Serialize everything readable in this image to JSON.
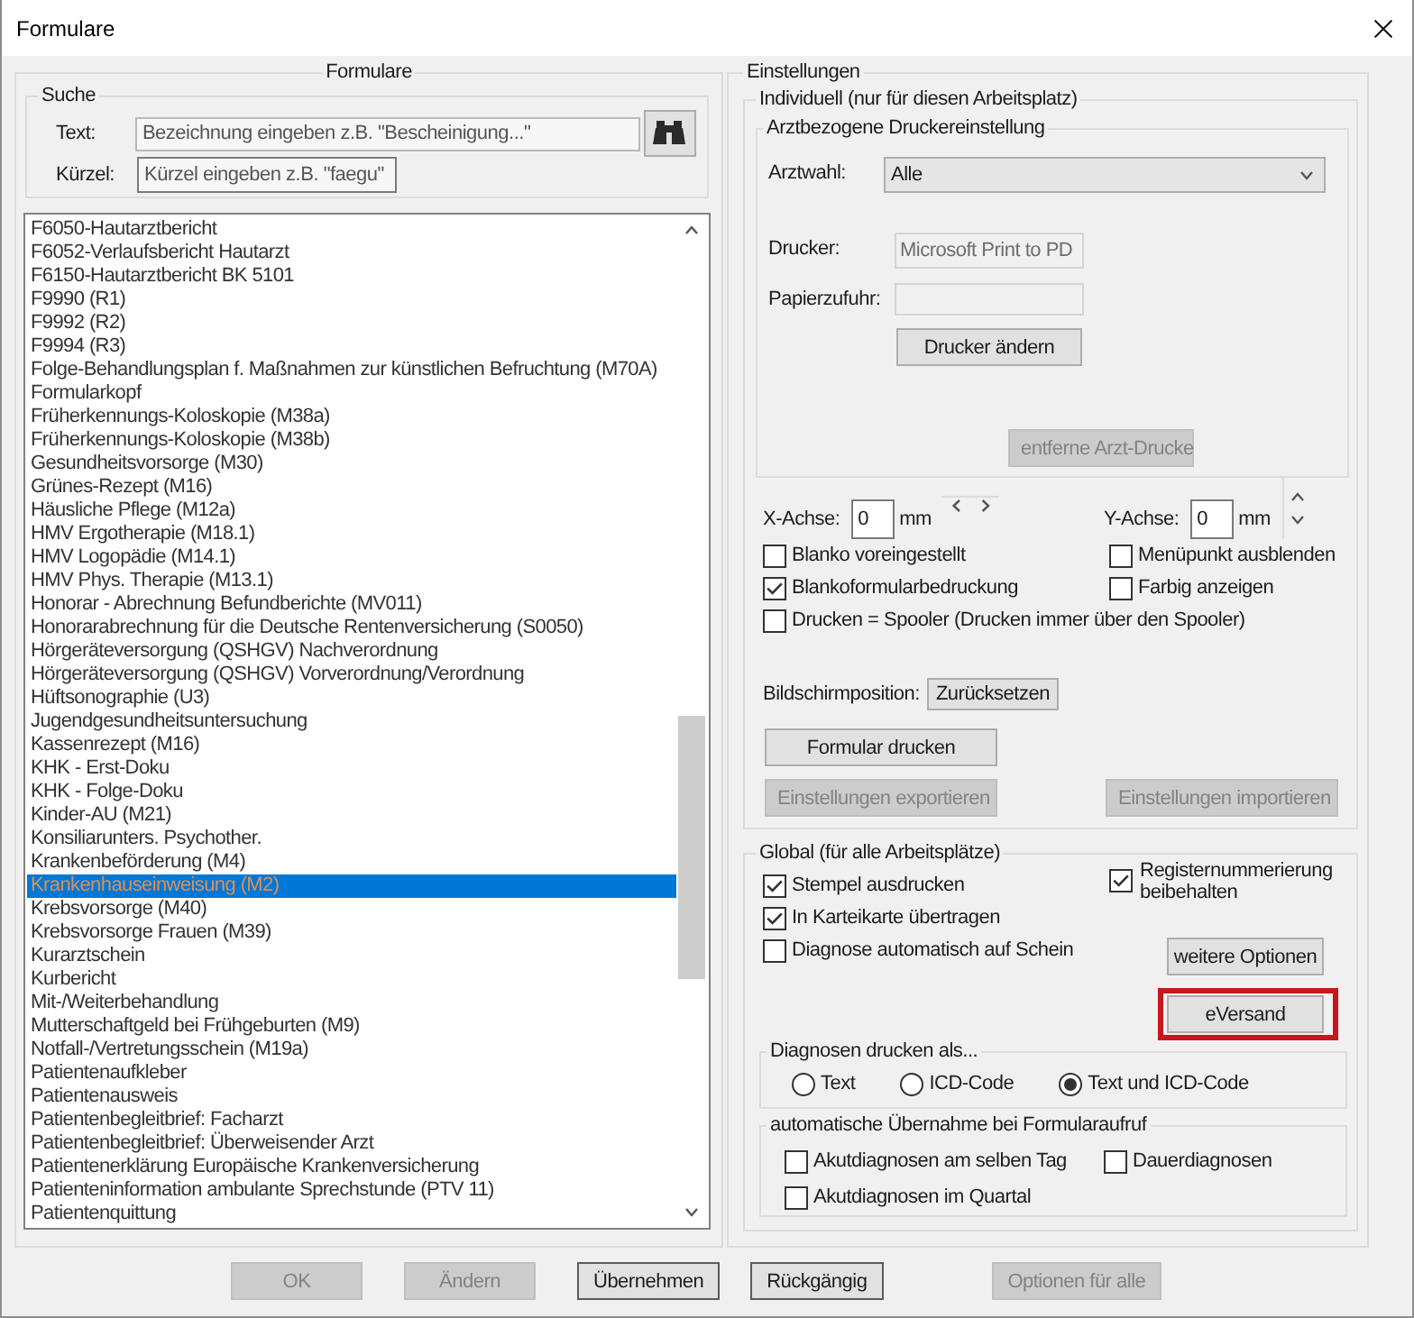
{
  "window": {
    "title": "Formulare"
  },
  "forms_panel": {
    "title": "Formulare",
    "search": {
      "title": "Suche",
      "fields": [
        {
          "label": "Text:",
          "placeholder": "Bezeichnung eingeben z.B. \"Bescheinigung...\""
        },
        {
          "label": "Kürzel:",
          "placeholder": "Kürzel eingeben z.B. \"faegu\""
        }
      ]
    },
    "forms": [
      {
        "label": "F6050-Hautarztbericht",
        "selected": false
      },
      {
        "label": "F6052-Verlaufsbericht Hautarzt",
        "selected": false
      },
      {
        "label": "F6150-Hautarztbericht BK 5101",
        "selected": false
      },
      {
        "label": "F9990 (R1)",
        "selected": false
      },
      {
        "label": "F9992 (R2)",
        "selected": false
      },
      {
        "label": "F9994 (R3)",
        "selected": false
      },
      {
        "label": "Folge-Behandlungsplan f. Maßnahmen zur künstlichen Befruchtung (M70A)",
        "selected": false
      },
      {
        "label": "Formularkopf",
        "selected": false
      },
      {
        "label": "Früherkennungs-Koloskopie (M38a)",
        "selected": false
      },
      {
        "label": "Früherkennungs-Koloskopie (M38b)",
        "selected": false
      },
      {
        "label": "Gesundheitsvorsorge (M30)",
        "selected": false
      },
      {
        "label": "Grünes-Rezept (M16)",
        "selected": false
      },
      {
        "label": "Häusliche Pflege (M12a)",
        "selected": false
      },
      {
        "label": "HMV Ergotherapie (M18.1)",
        "selected": false
      },
      {
        "label": "HMV Logopädie (M14.1)",
        "selected": false
      },
      {
        "label": "HMV Phys. Therapie (M13.1)",
        "selected": false
      },
      {
        "label": "Honorar - Abrechnung Befundberichte (MV011)",
        "selected": false
      },
      {
        "label": "Honorarabrechnung für die Deutsche Rentenversicherung (S0050)",
        "selected": false
      },
      {
        "label": "Hörgeräteversorgung (QSHGV) Nachverordnung",
        "selected": false
      },
      {
        "label": "Hörgeräteversorgung (QSHGV) Vorverordnung/Verordnung",
        "selected": false
      },
      {
        "label": "Hüftsonographie (U3)",
        "selected": false
      },
      {
        "label": "Jugendgesundheitsuntersuchung",
        "selected": false
      },
      {
        "label": "Kassenrezept (M16)",
        "selected": false
      },
      {
        "label": "KHK - Erst-Doku",
        "selected": false
      },
      {
        "label": "KHK - Folge-Doku",
        "selected": false
      },
      {
        "label": "Kinder-AU (M21)",
        "selected": false
      },
      {
        "label": "Konsiliarunters. Psychother.",
        "selected": false
      },
      {
        "label": "Krankenbeförderung (M4)",
        "selected": false
      },
      {
        "label": "Krankenhauseinweisung (M2)",
        "selected": true
      },
      {
        "label": "Krebsvorsorge (M40)",
        "selected": false
      },
      {
        "label": "Krebsvorsorge Frauen (M39)",
        "selected": false
      },
      {
        "label": "Kurarztschein",
        "selected": false
      },
      {
        "label": "Kurbericht",
        "selected": false
      },
      {
        "label": "Mit-/Weiterbehandlung",
        "selected": false
      },
      {
        "label": "Mutterschaftgeld bei Frühgeburten (M9)",
        "selected": false
      },
      {
        "label": "Notfall-/Vertretungsschein (M19a)",
        "selected": false
      },
      {
        "label": "Patientenaufkleber",
        "selected": false
      },
      {
        "label": "Patientenausweis",
        "selected": false
      },
      {
        "label": "Patientenbegleitbrief: Facharzt",
        "selected": false
      },
      {
        "label": "Patientenbegleitbrief: Überweisender Arzt",
        "selected": false
      },
      {
        "label": "Patientenerklärung Europäische Krankenversicherung",
        "selected": false
      },
      {
        "label": "Patienteninformation ambulante Sprechstunde (PTV 11)",
        "selected": false
      },
      {
        "label": "Patientenquittung",
        "selected": false
      }
    ]
  },
  "settings": {
    "title": "Einstellungen",
    "individual": {
      "title": "Individuell (nur für diesen Arbeitsplatz)",
      "printer_group": {
        "title": "Arztbezogene Druckereinstellung",
        "doctor": {
          "label": "Arztwahl:",
          "value": "Alle"
        },
        "printer": {
          "label": "Drucker:",
          "value": "Microsoft Print to PD",
          "disabled": true
        },
        "paper_tray": {
          "label": "Papierzufuhr:",
          "disabled": true
        },
        "buttons": [
          {
            "label": "Drucker ändern",
            "disabled": false
          },
          {
            "label": "entferne Arzt-Drucke",
            "disabled": true
          }
        ]
      },
      "offsets": [
        {
          "label": "X-Achse:",
          "value": "0",
          "unit": "mm",
          "kind": "horizontal"
        },
        {
          "label": "Y-Achse:",
          "value": "0",
          "unit": "mm",
          "kind": "vertical"
        }
      ],
      "options": [
        {
          "label": "Blanko voreingestellt",
          "checked": false
        },
        {
          "label": "Menüpunkt ausblenden",
          "checked": false
        },
        {
          "label": "Blankoformularbedruckung",
          "checked": true
        },
        {
          "label": "Farbig anzeigen",
          "checked": false
        },
        {
          "label": "Drucken = Spooler (Drucken immer über den Spooler)",
          "checked": false
        }
      ],
      "screen_position": {
        "label": "Bildschirmposition:",
        "button": "Zurücksetzen"
      },
      "print_button": {
        "label": "Formular drucken",
        "disabled": false
      },
      "transfer_buttons": [
        {
          "label": "Einstellungen exportieren",
          "disabled": true
        },
        {
          "label": "Einstellungen importieren",
          "disabled": true
        }
      ]
    },
    "global": {
      "title": "Global (für alle Arbeitsplätze)",
      "options": [
        {
          "label": "Stempel ausdrucken",
          "checked": true
        },
        {
          "label": "In Karteikarte übertragen",
          "checked": true
        },
        {
          "label": "Diagnose automatisch auf Schein",
          "checked": false
        }
      ],
      "register_option": {
        "label": "Registernummerierung beibehalten",
        "checked": true
      },
      "buttons": [
        {
          "label": "weitere Optionen",
          "highlighted": false
        },
        {
          "label": "eVersand",
          "highlighted": true
        }
      ],
      "diagnosis_format": {
        "title": "Diagnosen drucken als...",
        "options": [
          {
            "label": "Text",
            "selected": false
          },
          {
            "label": "ICD-Code",
            "selected": false
          },
          {
            "label": "Text und ICD-Code",
            "selected": true
          }
        ]
      },
      "auto_import": {
        "title": "automatische Übernahme bei Formularaufruf",
        "options": [
          {
            "label": "Akutdiagnosen am selben Tag",
            "checked": false
          },
          {
            "label": "Dauerdiagnosen",
            "checked": false
          },
          {
            "label": "Akutdiagnosen im Quartal",
            "checked": false
          }
        ]
      }
    }
  },
  "footer": {
    "form_buttons": [
      {
        "label": "OK",
        "disabled": true
      },
      {
        "label": "Ändern",
        "disabled": true
      },
      {
        "label": "Übernehmen",
        "disabled": false
      }
    ],
    "settings_buttons": [
      {
        "label": "Rückgängig",
        "disabled": false
      },
      {
        "label": "Optionen für alle",
        "disabled": true
      }
    ]
  }
}
